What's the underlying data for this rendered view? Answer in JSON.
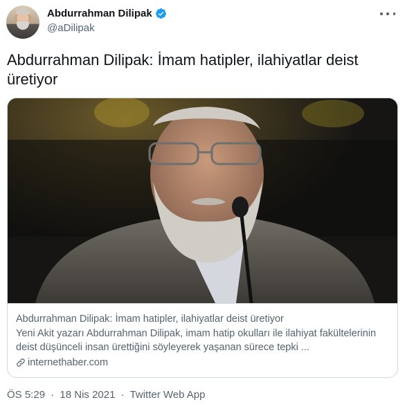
{
  "author": {
    "display_name": "Abdurrahman Dilipak",
    "handle": "@aDilipak",
    "verified": true,
    "avatar_icon": "profile-photo"
  },
  "tweet": {
    "text": "Abdurrahman Dilipak: İmam hatipler, ilahiyatlar deist üretiyor"
  },
  "card": {
    "image_description": "photo-of-speaker-at-microphone",
    "title": "Abdurrahman Dilipak: İmam hatipler, ilahiyatlar deist üretiyor",
    "description": "Yeni Akit yazarı Abdurrahman Dilipak, imam hatip okulları ile ilahiyat fakültelerinin deist düşünceli insan ürettiğini söyleyerek yaşanan sürece tepki ...",
    "domain": "internethaber.com"
  },
  "meta": {
    "time": "ÖS 5:29",
    "date": "18 Nis 2021",
    "separator": "·",
    "source": "Twitter Web App"
  },
  "colors": {
    "text_primary": "#0f1419",
    "text_secondary": "#536471",
    "verified_blue": "#1d9bf0",
    "border": "#cfd9de"
  }
}
